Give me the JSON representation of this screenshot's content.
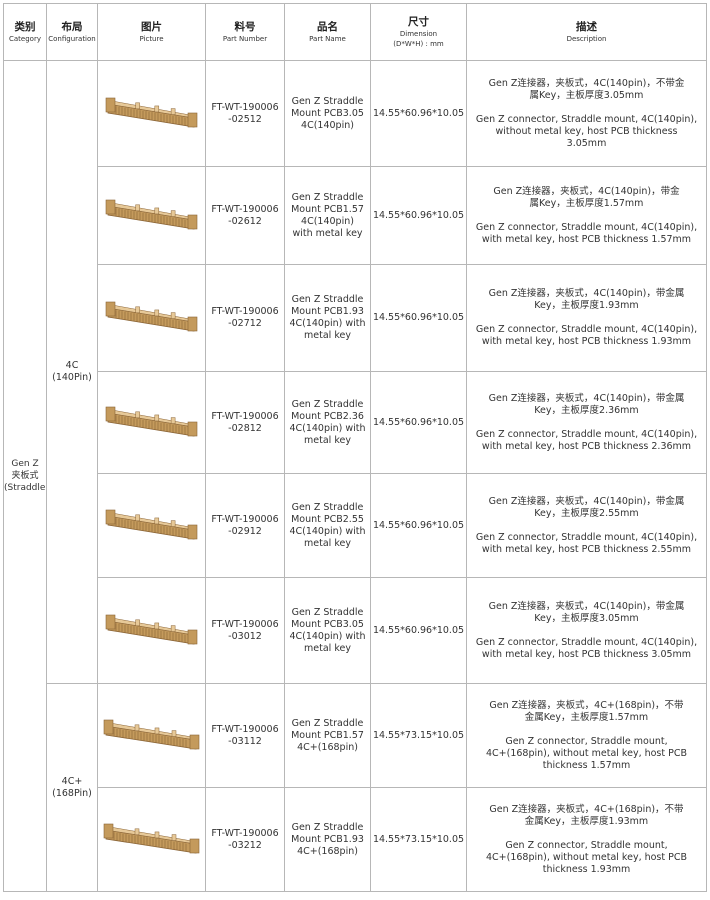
{
  "header": {
    "category_zh": "类别",
    "category_en": "Category",
    "config_zh": "布局",
    "config_en": "Configuration",
    "picture_zh": "图片",
    "picture_en": "Picture",
    "partno_zh": "料号",
    "partno_en": "Part Number",
    "partname_zh": "品名",
    "partname_en": "Part Name",
    "dimension_zh": "尺寸",
    "dimension_en": "Dimension",
    "dimension_unit": "(D*W*H) : mm",
    "desc_zh": "描述",
    "desc_en": "Description"
  },
  "category": {
    "line1": "Gen Z",
    "line2": "夹板式",
    "line3": "(Straddle)"
  },
  "configs": [
    {
      "line1": "4C",
      "line2": "(140Pin)"
    },
    {
      "line1": "4C+",
      "line2": "(168Pin)"
    }
  ],
  "colors": {
    "connector_body": "#c49a5c",
    "connector_shadow": "#8a6436",
    "connector_highlight": "#e7c998",
    "border": "#b7b7b7"
  },
  "rows": [
    {
      "pn1": "FT-WT-190006",
      "pn2": "-02512",
      "name1": "Gen Z Straddle",
      "name2": "Mount PCB3.05",
      "name3": "4C(140pin)",
      "name4": "",
      "dim": "14.55*60.96*10.05",
      "zh1": "Gen Z连接器，夹板式，4C(140pin)，不带金",
      "zh2": "属Key，主板厚度3.05mm",
      "en1": "Gen Z connector, Straddle mount, 4C(140pin),",
      "en2": "without metal key, host PCB thickness",
      "en3": "3.05mm"
    },
    {
      "pn1": "FT-WT-190006",
      "pn2": "-02612",
      "name1": "Gen Z Straddle",
      "name2": "Mount PCB1.57",
      "name3": "4C(140pin)",
      "name4": "with metal key",
      "dim": "14.55*60.96*10.05",
      "zh1": "Gen Z连接器，夹板式，4C(140pin)，带金",
      "zh2": "属Key，主板厚度1.57mm",
      "en1": "Gen Z connector, Straddle mount, 4C(140pin),",
      "en2": "with metal key, host PCB thickness 1.57mm",
      "en3": ""
    },
    {
      "pn1": "FT-WT-190006",
      "pn2": "-02712",
      "name1": "Gen Z Straddle",
      "name2": "Mount PCB1.93",
      "name3": "4C(140pin) with",
      "name4": "metal key",
      "dim": "14.55*60.96*10.05",
      "zh1": "Gen Z连接器，夹板式，4C(140pin)，带金属",
      "zh2": "Key，主板厚度1.93mm",
      "en1": "Gen Z connector, Straddle mount, 4C(140pin),",
      "en2": "with metal key, host PCB thickness 1.93mm",
      "en3": ""
    },
    {
      "pn1": "FT-WT-190006",
      "pn2": "-02812",
      "name1": "Gen Z Straddle",
      "name2": "Mount PCB2.36",
      "name3": "4C(140pin) with",
      "name4": "metal key",
      "dim": "14.55*60.96*10.05",
      "zh1": "Gen Z连接器，夹板式，4C(140pin)，带金属",
      "zh2": "Key，主板厚度2.36mm",
      "en1": "Gen Z connector, Straddle mount, 4C(140pin),",
      "en2": "with metal key, host PCB thickness 2.36mm",
      "en3": ""
    },
    {
      "pn1": "FT-WT-190006",
      "pn2": "-02912",
      "name1": "Gen Z Straddle",
      "name2": "Mount PCB2.55",
      "name3": "4C(140pin) with",
      "name4": "metal key",
      "dim": "14.55*60.96*10.05",
      "zh1": "Gen Z连接器，夹板式，4C(140pin)，带金属",
      "zh2": "Key，主板厚度2.55mm",
      "en1": "Gen Z connector, Straddle mount, 4C(140pin),",
      "en2": "with metal key, host PCB thickness 2.55mm",
      "en3": ""
    },
    {
      "pn1": "FT-WT-190006",
      "pn2": "-03012",
      "name1": "Gen Z Straddle",
      "name2": "Mount PCB3.05",
      "name3": "4C(140pin) with",
      "name4": "metal key",
      "dim": "14.55*60.96*10.05",
      "zh1": "Gen Z连接器，夹板式，4C(140pin)，带金属",
      "zh2": "Key，主板厚度3.05mm",
      "en1": "Gen Z connector, Straddle mount, 4C(140pin),",
      "en2": "with metal key, host PCB thickness 3.05mm",
      "en3": ""
    },
    {
      "pn1": "FT-WT-190006",
      "pn2": "-03112",
      "name1": "Gen Z Straddle",
      "name2": "Mount PCB1.57",
      "name3": "4C+(168pin)",
      "name4": "",
      "dim": "14.55*73.15*10.05",
      "zh1": "Gen Z连接器，夹板式，4C+(168pin)，不带",
      "zh2": "金属Key，主板厚度1.57mm",
      "en1": "Gen Z connector, Straddle mount,",
      "en2": "4C+(168pin), without metal key, host PCB",
      "en3": "thickness 1.57mm"
    },
    {
      "pn1": "FT-WT-190006",
      "pn2": "-03212",
      "name1": "Gen Z Straddle",
      "name2": "Mount PCB1.93",
      "name3": "4C+(168pin)",
      "name4": "",
      "dim": "14.55*73.15*10.05",
      "zh1": "Gen Z连接器，夹板式，4C+(168pin)，不带",
      "zh2": "金属Key，主板厚度1.93mm",
      "en1": "Gen Z connector, Straddle mount,",
      "en2": "4C+(168pin), without metal key, host PCB",
      "en3": "thickness 1.93mm"
    }
  ]
}
